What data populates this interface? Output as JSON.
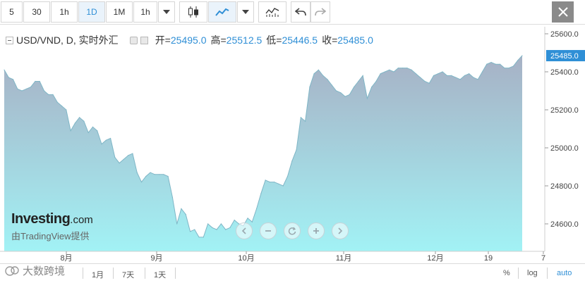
{
  "toolbar": {
    "intervals": [
      "5",
      "30",
      "1h",
      "1D",
      "1M",
      "1h"
    ],
    "selected_index": 3
  },
  "legend": {
    "symbol": "USD/VND, D, 实时外汇",
    "open_label": "开=",
    "open": "25495.0",
    "high_label": "高=",
    "high": "25512.5",
    "low_label": "低=",
    "low": "25446.5",
    "close_label": "收=",
    "close": "25485.0"
  },
  "branding": {
    "logo": "Investing",
    "logo_suffix": ".com",
    "powered_by": "由TradingView提供"
  },
  "bottom": {
    "ranges": [
      "1月",
      "7天",
      "1天"
    ],
    "percent": "%",
    "log": "log",
    "auto": "auto",
    "watermark": "大数跨境"
  },
  "colors": {
    "accent": "#2f8fd6",
    "price_badge": "#2f8fd6",
    "line": "#7fb6c6",
    "area_top": "#a7b1c5",
    "area_bottom": "#a2f2f5"
  },
  "chart_data": {
    "type": "area",
    "symbol": "USD/VND",
    "x_tick_labels": [
      "8月",
      "9月",
      "10月",
      "11月",
      "12月",
      "19",
      "7"
    ],
    "y_tick_labels": [
      "25600.0",
      "25400.0",
      "25200.0",
      "25000.0",
      "24800.0",
      "24600.0"
    ],
    "ylim": [
      24450,
      25620
    ],
    "last_price_label": "25485.0",
    "values": [
      25410,
      25370,
      25360,
      25310,
      25300,
      25310,
      25320,
      25350,
      25350,
      25300,
      25280,
      25280,
      25240,
      25220,
      25200,
      25090,
      25130,
      25160,
      25140,
      25080,
      25110,
      25090,
      25020,
      25040,
      25050,
      24950,
      24920,
      24940,
      24960,
      24970,
      24870,
      24820,
      24850,
      24870,
      24860,
      24860,
      24860,
      24850,
      24740,
      24600,
      24680,
      24650,
      24560,
      24570,
      24530,
      24530,
      24600,
      24580,
      24570,
      24600,
      24570,
      24580,
      24620,
      24600,
      24590,
      24630,
      24610,
      24680,
      24760,
      24830,
      24820,
      24820,
      24810,
      24800,
      24850,
      24930,
      24990,
      25160,
      25140,
      25320,
      25390,
      25410,
      25380,
      25360,
      25330,
      25300,
      25290,
      25270,
      25280,
      25320,
      25350,
      25380,
      25260,
      25320,
      25350,
      25390,
      25400,
      25410,
      25400,
      25420,
      25420,
      25420,
      25410,
      25390,
      25370,
      25350,
      25340,
      25380,
      25390,
      25400,
      25380,
      25380,
      25370,
      25360,
      25380,
      25390,
      25370,
      25360,
      25400,
      25440,
      25450,
      25440,
      25440,
      25420,
      25420,
      25430,
      25460,
      25485
    ]
  }
}
